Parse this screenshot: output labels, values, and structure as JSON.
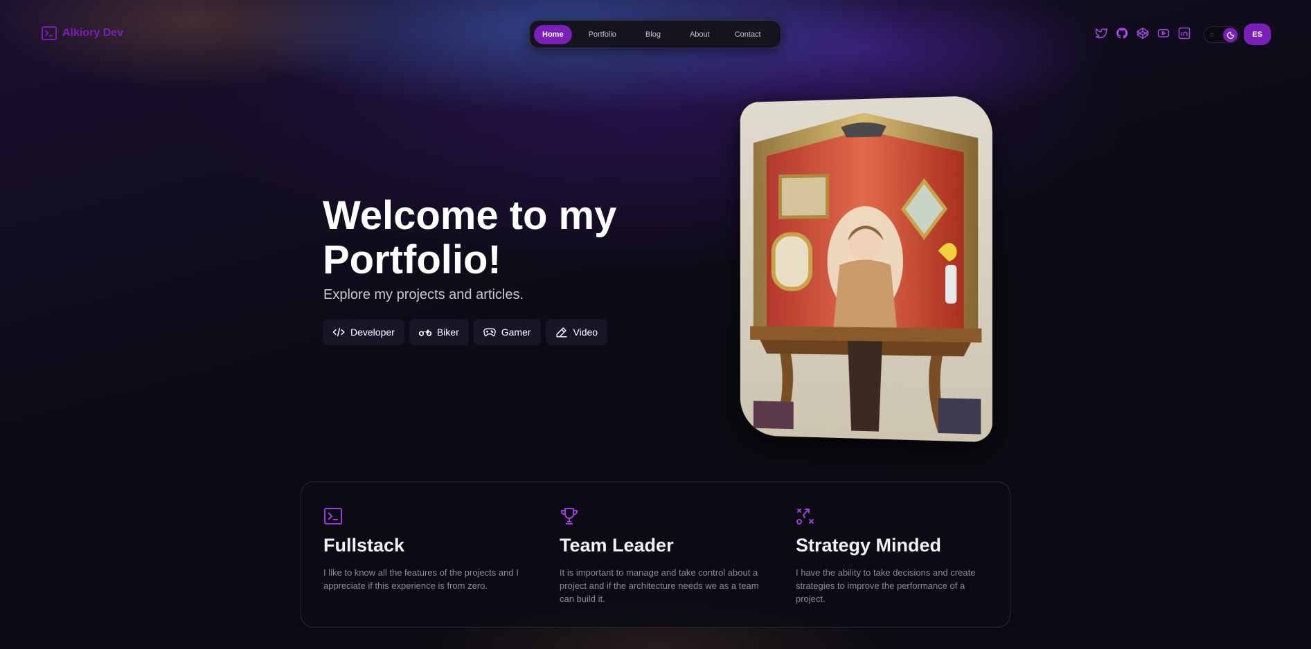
{
  "brand": {
    "name": "Alkiory Dev",
    "icon": "terminal-icon"
  },
  "nav": {
    "items": [
      {
        "label": "Home",
        "active": true
      },
      {
        "label": "Portfolio",
        "active": false
      },
      {
        "label": "Blog",
        "active": false
      },
      {
        "label": "About",
        "active": false
      },
      {
        "label": "Contact",
        "active": false
      }
    ]
  },
  "socials": [
    "twitter-icon",
    "github-icon",
    "codepen-icon",
    "youtube-icon",
    "linkedin-icon"
  ],
  "theme_toggle": {
    "mode": "dark"
  },
  "language": {
    "label": "ES"
  },
  "hero": {
    "title": "Welcome to my Portfolio!",
    "subtitle": "Explore my projects and articles.",
    "chips": [
      {
        "label": "Developer",
        "icon": "code-icon"
      },
      {
        "label": "Biker",
        "icon": "motorbike-icon"
      },
      {
        "label": "Gamer",
        "icon": "gamepad-icon"
      },
      {
        "label": "Video",
        "icon": "pencil-icon"
      }
    ]
  },
  "features": [
    {
      "title": "Fullstack",
      "icon": "terminal-icon",
      "text": "I like to know all the features of the projects and I appreciate if this experience is from zero."
    },
    {
      "title": "Team Leader",
      "icon": "trophy-icon",
      "text": "It is important to manage and take control about a project and if the architecture needs we as a team can build it."
    },
    {
      "title": "Strategy Minded",
      "icon": "strategy-icon",
      "text": "I have the ability to take decisions and create strategies to improve the performance of a project."
    }
  ],
  "colors": {
    "accent": "#7a1fb8",
    "background": "#0b0a12"
  }
}
